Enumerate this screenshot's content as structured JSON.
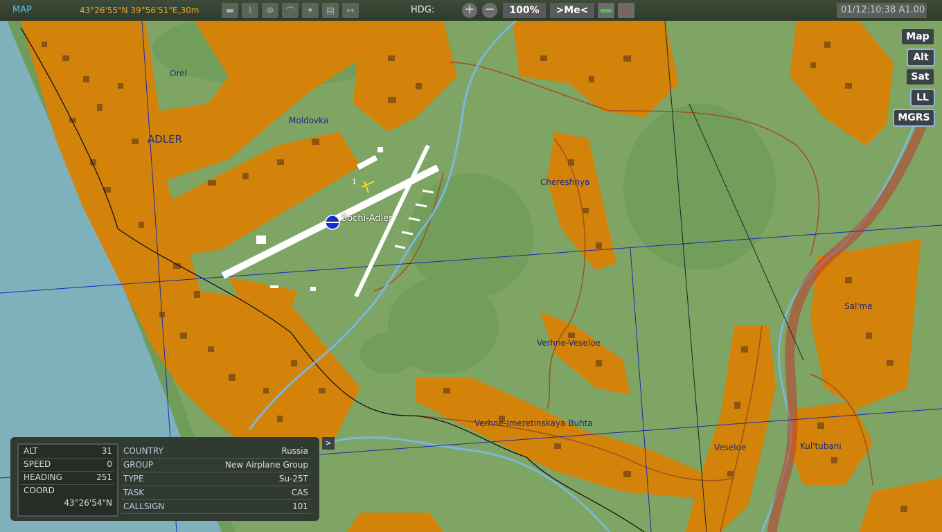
{
  "topbar": {
    "mode": "MAP",
    "coords": "43°26'55\"N 39°56'51\"E,30m",
    "hdg_label": "HDG:",
    "zoom_in": "+",
    "zoom_out": "−",
    "zoom_level": "100%",
    "center_me": ">Me<",
    "clock": "01/12:10:38 A1.00"
  },
  "layers": {
    "map": "Map",
    "alt": "Alt",
    "sat": "Sat",
    "ll": "LL",
    "mgrs": "MGRS"
  },
  "map_labels": {
    "orel": "Orel",
    "adler": "ADLER",
    "moldovka": "Moldovka",
    "chereshnya": "Chereshnya",
    "verhne_veseloe": "Verhne-Veseloe",
    "imeretinskaya": "Verhne-Imeretinskaya Buhta",
    "veseloe": "Veseloe",
    "kultubani": "Kul'tubani",
    "salme": "Sal'me",
    "airfield": "Sochi-Adler",
    "unit_marker": "1"
  },
  "unit_panel": {
    "alt_label": "ALT",
    "alt_value": "31",
    "speed_label": "SPEED",
    "speed_value": "0",
    "heading_label": "HEADING",
    "heading_value": "251",
    "coord_label": "COORD",
    "coord_value": "43°26'54\"N",
    "country_label": "COUNTRY",
    "country_value": "Russia",
    "group_label": "GROUP",
    "group_value": "New Airplane Group",
    "type_label": "TYPE",
    "type_value": "Su-25T",
    "task_label": "TASK",
    "task_value": "CAS",
    "callsign_label": "CALLSIGN",
    "callsign_value": "101",
    "expand": ">"
  },
  "colors": {
    "terrain": "#7fa564",
    "sea": "#7fb1bd",
    "town": "#d4830a",
    "building": "#8a5412",
    "river": "#7ab8d8",
    "ridge": "#c0392b",
    "grid": "#1a2ab0"
  }
}
